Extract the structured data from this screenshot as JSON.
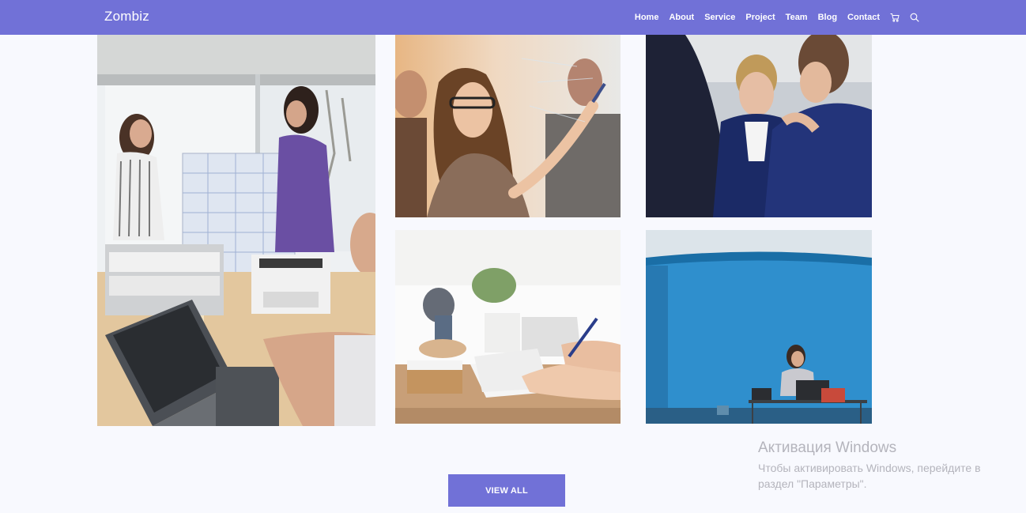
{
  "navbar": {
    "brand": "Zombiz",
    "links": [
      "Home",
      "About",
      "Service",
      "Project",
      "Team",
      "Blog",
      "Contact"
    ],
    "icons": [
      "cart-icon",
      "search-icon"
    ]
  },
  "gallery": {
    "button_label": "VIEW ALL",
    "photos": [
      "team-planning-photo",
      "whiteboard-writing-photo",
      "business-meeting-photo",
      "desk-writing-photo",
      "blue-room-office-photo"
    ]
  },
  "watermark": {
    "title": "Активация Windows",
    "text": "Чтобы активировать Windows, перейдите в раздел \"Параметры\"."
  },
  "colors": {
    "accent": "#7171d7",
    "background": "#f8f9fe",
    "watermark_text": "#b4b4bc"
  }
}
